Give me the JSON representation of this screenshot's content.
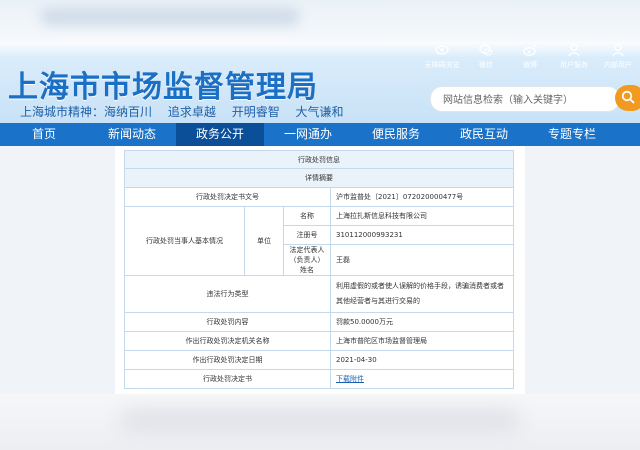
{
  "header": {
    "site_title": "上海市市场监督管理局",
    "spirit": [
      "上海城市精神：海纳百川",
      "追求卓越",
      "开明睿智",
      "大气谦和"
    ],
    "tools": [
      {
        "label": "无障碍浏览",
        "icon": "eye-icon"
      },
      {
        "label": "微信",
        "icon": "wechat-icon"
      },
      {
        "label": "微博",
        "icon": "weibo-icon"
      },
      {
        "label": "用户服务",
        "icon": "user-icon"
      },
      {
        "label": "内部用户",
        "icon": "user-icon"
      }
    ],
    "search": {
      "placeholder": "网站信息检索（输入关键字）"
    }
  },
  "nav": {
    "items": [
      {
        "label": "首页"
      },
      {
        "label": "新闻动态"
      },
      {
        "label": "政务公开",
        "active": true
      },
      {
        "label": "一网通办"
      },
      {
        "label": "便民服务"
      },
      {
        "label": "政民互动"
      },
      {
        "label": "专题专栏"
      }
    ]
  },
  "penalty": {
    "title": "行政处罚信息",
    "subtitle": "详情摘要",
    "decision_no_label": "行政处罚决定书文号",
    "decision_no": "沪市监普处〔2021〕072020000477号",
    "party_label": "行政处罚当事人基本情况",
    "unit_label": "单位",
    "name_label": "名称",
    "name": "上海拉扎斯信息科技有限公司",
    "reg_label": "注册号",
    "reg": "310112000993231",
    "rep_label": "法定代表人（负责人）姓名",
    "rep": "王磊",
    "violation_label": "违法行为类型",
    "violation": "利用虚假的或者使人误解的价格手段，诱骗消费者或者其他经营者与其进行交易的",
    "content_label": "行政处罚内容",
    "content": "罚款50.0000万元",
    "authority_label": "作出行政处罚决定机关名称",
    "authority": "上海市普陀区市场监督管理局",
    "date_label": "作出行政处罚决定日期",
    "date": "2021-04-30",
    "doc_label": "行政处罚决定书",
    "doc_link": "下载附件"
  }
}
